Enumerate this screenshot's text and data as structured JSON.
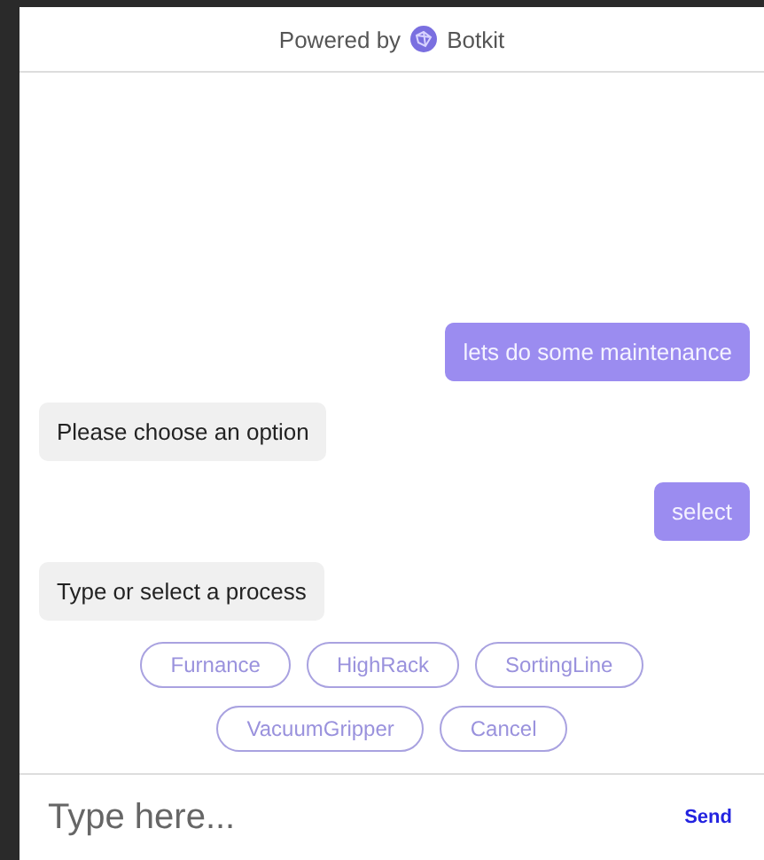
{
  "header": {
    "prefix": "Powered by",
    "brand": "Botkit"
  },
  "messages": [
    {
      "kind": "user",
      "text": "lets do some maintenance"
    },
    {
      "kind": "bot",
      "text": "Please choose an option"
    },
    {
      "kind": "user",
      "text": "select"
    },
    {
      "kind": "bot",
      "text": "Type or select a process"
    }
  ],
  "quick_replies": [
    "Furnance",
    "HighRack",
    "SortingLine",
    "VacuumGripper",
    "Cancel"
  ],
  "composer": {
    "placeholder": "Type here...",
    "send": "Send"
  }
}
